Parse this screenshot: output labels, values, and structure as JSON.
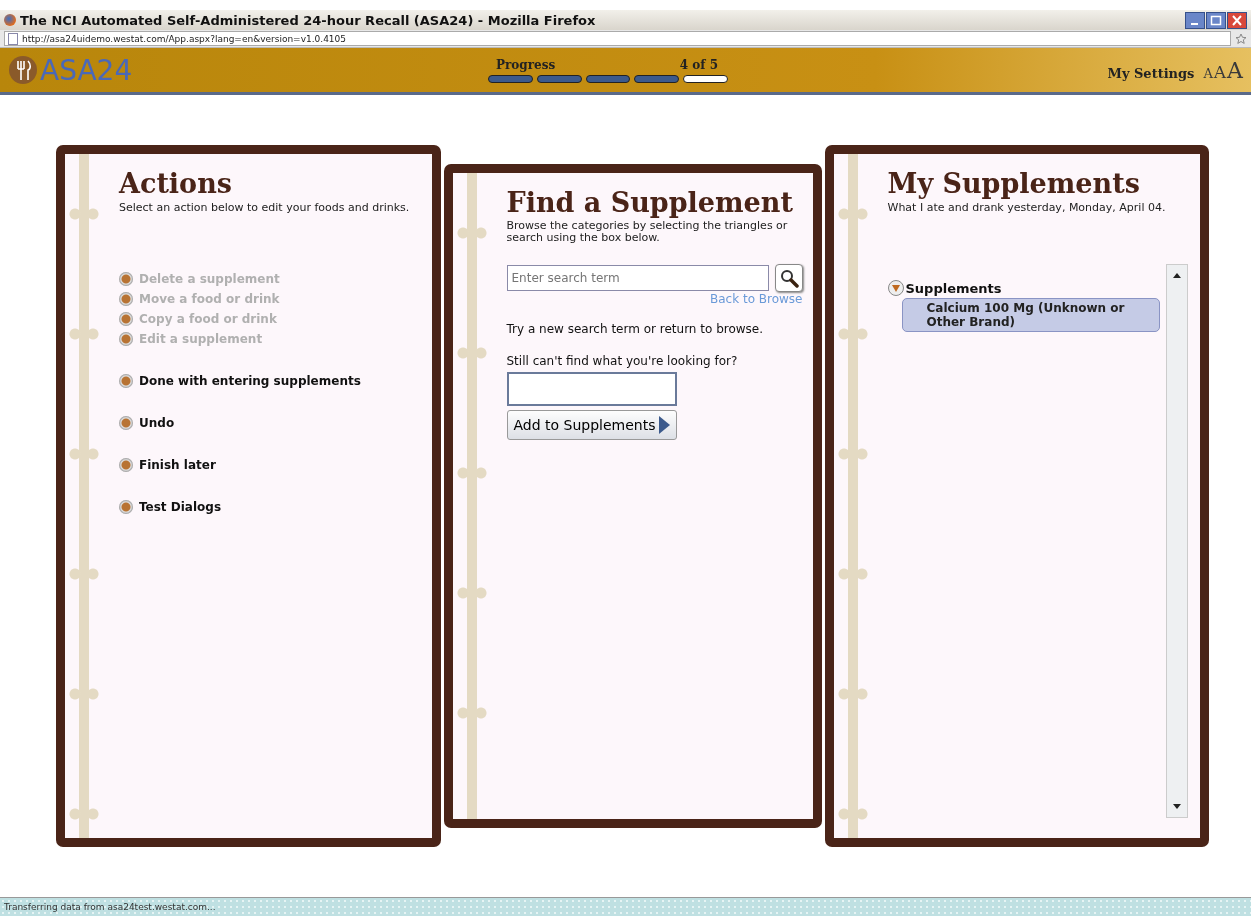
{
  "window": {
    "title": "The NCI Automated Self-Administered 24-hour Recall (ASA24) - Mozilla Firefox"
  },
  "address_bar": {
    "url": "http://asa24uidemo.westat.com/App.aspx?lang=en&version=v1.0.4105"
  },
  "header": {
    "logo": "ASA24",
    "progress_label": "Progress",
    "progress_count": "4 of 5",
    "progress_steps": [
      {
        "completed": true
      },
      {
        "completed": true
      },
      {
        "completed": true
      },
      {
        "completed": true
      },
      {
        "completed": false
      }
    ],
    "settings": "My Settings",
    "font_sizes": [
      "A",
      "A",
      "A"
    ]
  },
  "actions_panel": {
    "title": "Actions",
    "subtitle": "Select an action below to edit your foods and drinks.",
    "items": [
      {
        "label": "Delete a supplement",
        "disabled": true
      },
      {
        "label": "Move a food or drink",
        "disabled": true
      },
      {
        "label": "Copy a food or drink",
        "disabled": true
      },
      {
        "label": "Edit a supplement",
        "disabled": true
      },
      {
        "label": "Done with entering supplements",
        "disabled": false
      },
      {
        "label": "Undo",
        "disabled": false
      },
      {
        "label": "Finish later",
        "disabled": false
      },
      {
        "label": "Test Dialogs",
        "disabled": false
      }
    ]
  },
  "find_panel": {
    "title": "Find a Supplement",
    "subtitle": "Browse the categories by selecting the triangles or search using the box below.",
    "search": {
      "placeholder": "Enter search term"
    },
    "back_link": "Back to Browse",
    "message": "Try a new search term or return to browse.",
    "prompt": "Still can't find what you're looking for?",
    "add_button": "Add to Supplements"
  },
  "my_panel": {
    "title": "My Supplements",
    "subtitle": "What I ate and drank yesterday, Monday, April 04.",
    "tree": [
      {
        "label": "Supplements",
        "expanded": true,
        "children": [
          {
            "label": "Calcium 100 Mg (Unknown or Other Brand)",
            "selected": true
          }
        ]
      }
    ]
  },
  "status_bar": {
    "text": "Transferring data from asa24test.westat.com..."
  }
}
